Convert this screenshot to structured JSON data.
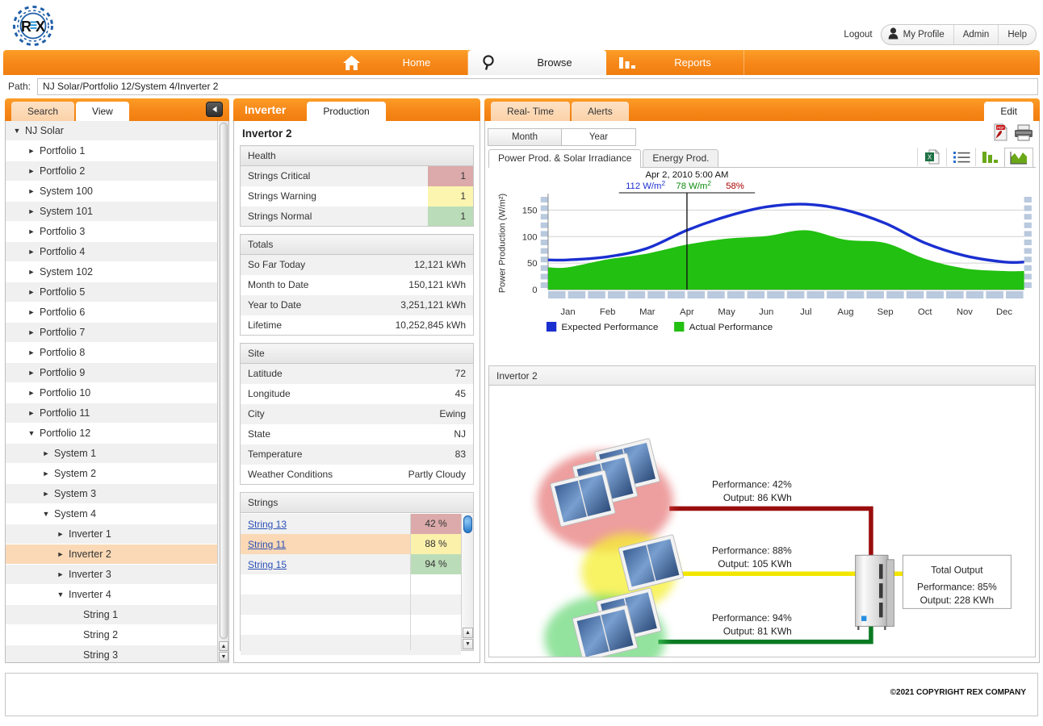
{
  "app": {
    "logo_text": "REX",
    "copyright": "©2021 COPYRIGHT REX COMPANY"
  },
  "header": {
    "logout_label": "Logout",
    "profile_label": "My Profile",
    "admin_label": "Admin",
    "help_label": "Help"
  },
  "nav": {
    "items": [
      {
        "label": "Home",
        "icon": "home-icon",
        "active": false
      },
      {
        "label": "Browse",
        "icon": "search-icon",
        "active": true
      },
      {
        "label": "Reports",
        "icon": "bar-chart-icon",
        "active": false
      }
    ]
  },
  "path": {
    "label": "Path:",
    "value": "NJ Solar/Portfolio 12/System 4/Inverter 2"
  },
  "sidebar": {
    "tabs": [
      {
        "label": "Search",
        "active": false
      },
      {
        "label": "View",
        "active": true
      }
    ],
    "collapse_icon": "chevron-left-icon",
    "tree": [
      {
        "label": "NJ Solar",
        "depth": 0,
        "twisty": "down",
        "selected": false
      },
      {
        "label": "Portfolio 1",
        "depth": 1,
        "twisty": "right",
        "selected": false
      },
      {
        "label": "Portfolio 2",
        "depth": 1,
        "twisty": "right",
        "selected": false
      },
      {
        "label": "System 100",
        "depth": 1,
        "twisty": "right",
        "selected": false
      },
      {
        "label": "System 101",
        "depth": 1,
        "twisty": "right",
        "selected": false
      },
      {
        "label": "Portfolio 3",
        "depth": 1,
        "twisty": "right",
        "selected": false
      },
      {
        "label": "Portfolio 4",
        "depth": 1,
        "twisty": "right",
        "selected": false
      },
      {
        "label": "System 102",
        "depth": 1,
        "twisty": "right",
        "selected": false
      },
      {
        "label": "Portfolio 5",
        "depth": 1,
        "twisty": "right",
        "selected": false
      },
      {
        "label": "Portfolio 6",
        "depth": 1,
        "twisty": "right",
        "selected": false
      },
      {
        "label": "Portfolio 7",
        "depth": 1,
        "twisty": "right",
        "selected": false
      },
      {
        "label": "Portfolio 8",
        "depth": 1,
        "twisty": "right",
        "selected": false
      },
      {
        "label": "Portfolio 9",
        "depth": 1,
        "twisty": "right",
        "selected": false
      },
      {
        "label": "Portfolio 10",
        "depth": 1,
        "twisty": "right",
        "selected": false
      },
      {
        "label": "Portfolio 11",
        "depth": 1,
        "twisty": "right",
        "selected": false
      },
      {
        "label": "Portfolio 12",
        "depth": 1,
        "twisty": "down",
        "selected": false
      },
      {
        "label": "System 1",
        "depth": 2,
        "twisty": "right",
        "selected": false
      },
      {
        "label": "System 2",
        "depth": 2,
        "twisty": "right",
        "selected": false
      },
      {
        "label": "System 3",
        "depth": 2,
        "twisty": "right",
        "selected": false
      },
      {
        "label": "System 4",
        "depth": 2,
        "twisty": "down",
        "selected": false
      },
      {
        "label": "Inverter 1",
        "depth": 3,
        "twisty": "right",
        "selected": false
      },
      {
        "label": "Inverter 2",
        "depth": 3,
        "twisty": "right",
        "selected": true
      },
      {
        "label": "Inverter 3",
        "depth": 3,
        "twisty": "right",
        "selected": false
      },
      {
        "label": "Inverter 4",
        "depth": 3,
        "twisty": "down",
        "selected": false
      },
      {
        "label": "String 1",
        "depth": 4,
        "twisty": "none",
        "selected": false
      },
      {
        "label": "String 2",
        "depth": 4,
        "twisty": "none",
        "selected": false
      },
      {
        "label": "String 3",
        "depth": 4,
        "twisty": "none",
        "selected": false
      }
    ]
  },
  "detail": {
    "panel_title": "Inverter",
    "entity_title": "Invertor 2",
    "health": {
      "header": "Health",
      "rows": [
        {
          "label": "Strings Critical",
          "value": "1",
          "state": "critical"
        },
        {
          "label": "Strings Warning",
          "value": "1",
          "state": "warning"
        },
        {
          "label": "Strings Normal",
          "value": "1",
          "state": "normal"
        }
      ]
    },
    "totals": {
      "header": "Totals",
      "rows": [
        {
          "label": "So Far Today",
          "value": "12,121 kWh"
        },
        {
          "label": "Month to Date",
          "value": "150,121 kWh"
        },
        {
          "label": "Year to Date",
          "value": "3,251,121 kWh"
        },
        {
          "label": "Lifetime",
          "value": "10,252,845 kWh"
        }
      ]
    },
    "site": {
      "header": "Site",
      "rows": [
        {
          "label": "Latitude",
          "value": "72"
        },
        {
          "label": "Longitude",
          "value": "45"
        },
        {
          "label": "City",
          "value": "Ewing"
        },
        {
          "label": "State",
          "value": "NJ"
        },
        {
          "label": "Temperature",
          "value": "83"
        },
        {
          "label": "Weather Conditions",
          "value": "Partly Cloudy"
        }
      ]
    },
    "strings": {
      "header": "Strings",
      "rows": [
        {
          "label": "String 13",
          "value": "42 %",
          "state": "critical",
          "selected": false
        },
        {
          "label": "String 11",
          "value": "88 %",
          "state": "warning",
          "selected": true
        },
        {
          "label": "String 15",
          "value": "94 %",
          "state": "normal",
          "selected": false
        }
      ]
    }
  },
  "content_tabs": [
    {
      "label": "Production",
      "active": true
    },
    {
      "label": "Real- Time",
      "active": false
    },
    {
      "label": "Alerts",
      "active": false
    }
  ],
  "edit_tab": {
    "label": "Edit",
    "active": true
  },
  "chart_panel": {
    "period": [
      {
        "label": "Month",
        "active": false
      },
      {
        "label": "Year",
        "active": true
      }
    ],
    "export_icons": [
      {
        "name": "pdf-icon"
      },
      {
        "name": "printer-icon"
      }
    ],
    "tabs": [
      {
        "label": "Power Prod. & Solar Irradiance",
        "active": true
      },
      {
        "label": "Energy Prod.",
        "active": false
      }
    ],
    "view_icons": [
      {
        "name": "excel-export-icon",
        "active": false
      },
      {
        "name": "list-view-icon",
        "active": false
      },
      {
        "name": "bar-chart-icon",
        "active": false
      },
      {
        "name": "area-chart-icon",
        "active": true
      }
    ]
  },
  "chart_data": {
    "type": "area",
    "title": "",
    "xlabel": "",
    "ylabel": "Power Production (W/m²)",
    "ylim": [
      0,
      175
    ],
    "yticks": [
      0,
      50,
      100,
      150
    ],
    "grid": true,
    "legend_position": "bottom-left",
    "categories": [
      "Jan",
      "Feb",
      "Mar",
      "Apr",
      "May",
      "Jun",
      "Jul",
      "Aug",
      "Sep",
      "Oct",
      "Nov",
      "Dec"
    ],
    "series": [
      {
        "name": "Expected Performance",
        "type": "line",
        "color": "#1a2fd0",
        "values": [
          56,
          62,
          78,
          112,
          138,
          156,
          161,
          150,
          125,
          88,
          64,
          52
        ]
      },
      {
        "name": "Actual Performance",
        "type": "area",
        "color": "#22c011",
        "values": [
          42,
          57,
          68,
          85,
          96,
          101,
          112,
          94,
          88,
          58,
          40,
          35
        ]
      }
    ],
    "annotation": {
      "timestamp": "Apr 2, 2010 5:00 AM",
      "expected_value": "112 W/m",
      "expected_sup": "2",
      "actual_value": "78 W/m",
      "actual_sup": "2",
      "percent": "58%",
      "expected_color": "#1a2fd0",
      "actual_color": "#0a8a0a",
      "percent_color": "#aa0000",
      "x_category": "Apr"
    }
  },
  "diagram": {
    "header": "Invertor 2",
    "strings": [
      {
        "perf_label": "Performance: 42%",
        "output_label": "Output: 86 KWh",
        "wire_color": "#9a0d0d",
        "glow_color": "#e88a8a",
        "panel_count": 3
      },
      {
        "perf_label": "Performance: 88%",
        "output_label": "Output: 105 KWh",
        "wire_color": "#f2e600",
        "glow_color": "#f7ef7a",
        "panel_count": 1
      },
      {
        "perf_label": "Performance: 94%",
        "output_label": "Output: 81 KWh",
        "wire_color": "#0a7a22",
        "glow_color": "#8fe39c",
        "panel_count": 2
      }
    ],
    "total": {
      "title": "Total Output",
      "performance": "Performance: 85%",
      "output": "Output: 228 KWh"
    }
  },
  "colors": {
    "brand_orange": "#f7891a",
    "critical": "#dcaaaa",
    "warning": "#fbf5b0",
    "normal": "#bbdcb8",
    "selected_row": "#fbd9b6"
  }
}
